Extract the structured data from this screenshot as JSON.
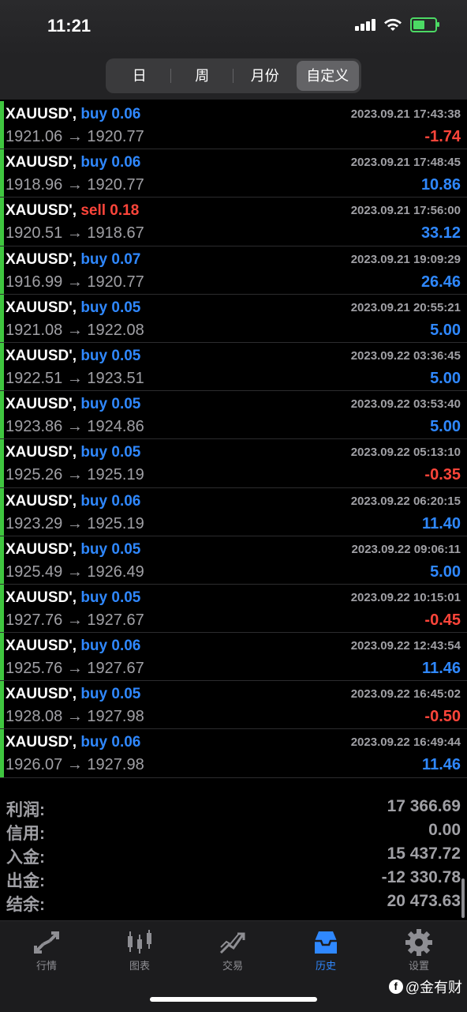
{
  "status": {
    "time": "11:21"
  },
  "segments": [
    "日",
    "周",
    "月份",
    "自定义"
  ],
  "active_segment": 3,
  "trades": [
    {
      "symbol": "XAUUSD'",
      "action": "buy",
      "volume": "0.06",
      "datetime": "2023.09.21 17:43:38",
      "prices": "1921.06 → 1920.77",
      "profit": "-1.74"
    },
    {
      "symbol": "XAUUSD'",
      "action": "buy",
      "volume": "0.06",
      "datetime": "2023.09.21 17:48:45",
      "prices": "1918.96 → 1920.77",
      "profit": "10.86"
    },
    {
      "symbol": "XAUUSD'",
      "action": "sell",
      "volume": "0.18",
      "datetime": "2023.09.21 17:56:00",
      "prices": "1920.51 → 1918.67",
      "profit": "33.12"
    },
    {
      "symbol": "XAUUSD'",
      "action": "buy",
      "volume": "0.07",
      "datetime": "2023.09.21 19:09:29",
      "prices": "1916.99 → 1920.77",
      "profit": "26.46"
    },
    {
      "symbol": "XAUUSD'",
      "action": "buy",
      "volume": "0.05",
      "datetime": "2023.09.21 20:55:21",
      "prices": "1921.08 → 1922.08",
      "profit": "5.00"
    },
    {
      "symbol": "XAUUSD'",
      "action": "buy",
      "volume": "0.05",
      "datetime": "2023.09.22 03:36:45",
      "prices": "1922.51 → 1923.51",
      "profit": "5.00"
    },
    {
      "symbol": "XAUUSD'",
      "action": "buy",
      "volume": "0.05",
      "datetime": "2023.09.22 03:53:40",
      "prices": "1923.86 → 1924.86",
      "profit": "5.00"
    },
    {
      "symbol": "XAUUSD'",
      "action": "buy",
      "volume": "0.05",
      "datetime": "2023.09.22 05:13:10",
      "prices": "1925.26 → 1925.19",
      "profit": "-0.35"
    },
    {
      "symbol": "XAUUSD'",
      "action": "buy",
      "volume": "0.06",
      "datetime": "2023.09.22 06:20:15",
      "prices": "1923.29 → 1925.19",
      "profit": "11.40"
    },
    {
      "symbol": "XAUUSD'",
      "action": "buy",
      "volume": "0.05",
      "datetime": "2023.09.22 09:06:11",
      "prices": "1925.49 → 1926.49",
      "profit": "5.00"
    },
    {
      "symbol": "XAUUSD'",
      "action": "buy",
      "volume": "0.05",
      "datetime": "2023.09.22 10:15:01",
      "prices": "1927.76 → 1927.67",
      "profit": "-0.45"
    },
    {
      "symbol": "XAUUSD'",
      "action": "buy",
      "volume": "0.06",
      "datetime": "2023.09.22 12:43:54",
      "prices": "1925.76 → 1927.67",
      "profit": "11.46"
    },
    {
      "symbol": "XAUUSD'",
      "action": "buy",
      "volume": "0.05",
      "datetime": "2023.09.22 16:45:02",
      "prices": "1928.08 → 1927.98",
      "profit": "-0.50"
    },
    {
      "symbol": "XAUUSD'",
      "action": "buy",
      "volume": "0.06",
      "datetime": "2023.09.22 16:49:44",
      "prices": "1926.07 → 1927.98",
      "profit": "11.46"
    }
  ],
  "summary": [
    {
      "label": "利润:",
      "value": "17 366.69"
    },
    {
      "label": "信用:",
      "value": "0.00"
    },
    {
      "label": "入金:",
      "value": "15 437.72"
    },
    {
      "label": "出金:",
      "value": "-12 330.78"
    },
    {
      "label": "结余:",
      "value": "20 473.63"
    }
  ],
  "tabs": [
    {
      "label": "行情",
      "icon": "quotes-icon"
    },
    {
      "label": "图表",
      "icon": "chart-icon"
    },
    {
      "label": "交易",
      "icon": "trade-icon"
    },
    {
      "label": "历史",
      "icon": "history-icon"
    },
    {
      "label": "设置",
      "icon": "settings-icon"
    }
  ],
  "active_tab": 3,
  "watermark": "@金有财",
  "colors": {
    "buy": "#2f88ff",
    "sell": "#ff453a",
    "profit_positive": "#2f88ff",
    "profit_negative": "#ff453a",
    "active_tab": "#2f88ff",
    "row_marker": "#3fc63f"
  }
}
